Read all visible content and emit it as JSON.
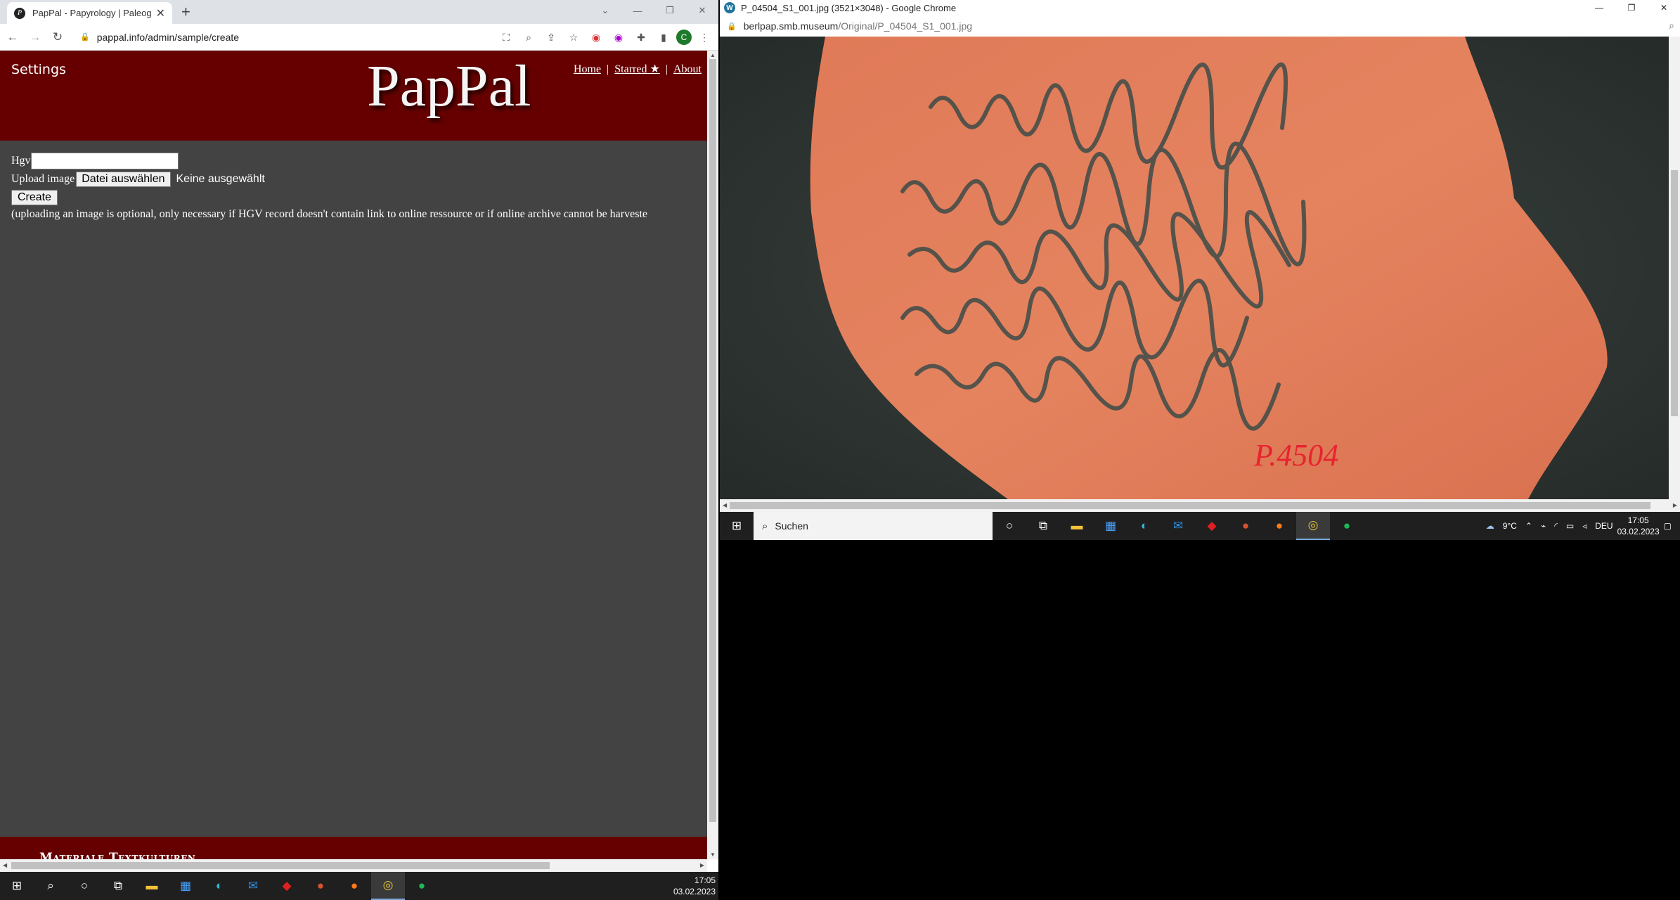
{
  "left_browser": {
    "tab_title": "PapPal - Papyrology | Paleograph",
    "url": "pappal.info/admin/sample/create",
    "profile_letter": "C"
  },
  "pappal": {
    "settings": "Settings",
    "logo": "PapPal",
    "nav": {
      "home": "Home",
      "starred": "Starred ★",
      "about": "About",
      "sep": "|"
    },
    "form": {
      "hgv_label": "Hgv",
      "upload_label": "Upload image",
      "file_button": "Datei auswählen",
      "file_none": "Keine ausgewählt",
      "create_button": "Create",
      "note": "(uploading an image is optional, only necessary if HGV record doesn't contain link to online ressource or if online archive cannot be harveste"
    },
    "footer": "Materiale Textkulturen"
  },
  "right_browser": {
    "title": "P_04504_S1_001.jpg (3521×3048) - Google Chrome",
    "url_host": "berlpap.smb.museum",
    "url_path": "/Original/P_04504_S1_001.jpg",
    "inventory_label": "P.4504"
  },
  "taskbar_left": {
    "time": "17:05",
    "date": "03.02.2023"
  },
  "taskbar_right": {
    "search_placeholder": "Suchen",
    "weather": "9°C",
    "language": "DEU",
    "time": "17:05",
    "date": "03.02.2023"
  }
}
